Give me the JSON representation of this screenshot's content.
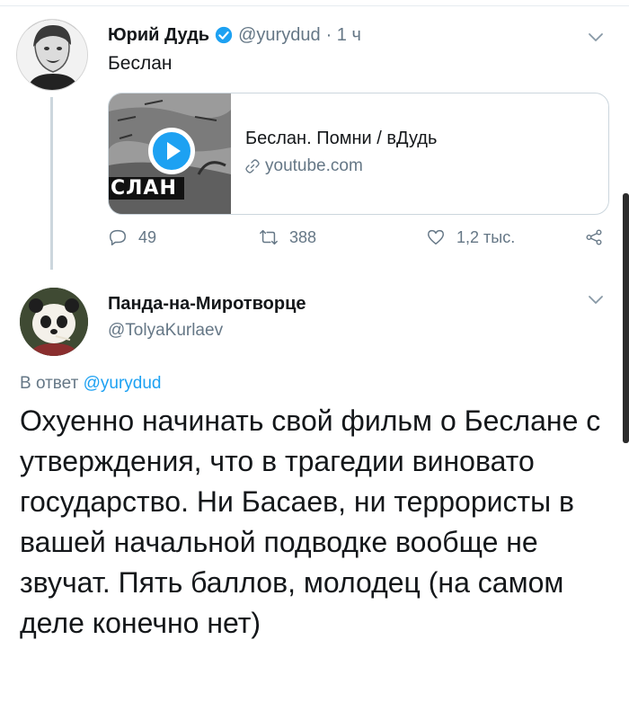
{
  "tweet1": {
    "author_name": "Юрий Дудь",
    "author_handle": "@yurydud",
    "time": "· 1 ч",
    "text": "Беслан",
    "card": {
      "thumbnail_caption": "СЛАН",
      "title": "Беслан. Помни / вДудь",
      "domain": "youtube.com"
    },
    "actions": {
      "replies": "49",
      "retweets": "388",
      "likes": "1,2 тыс."
    }
  },
  "tweet2": {
    "author_name": "Панда-на-Миротворце",
    "author_handle": "@TolyaKurlaev",
    "reply_prefix": "В ответ",
    "reply_mention": "@yurydud",
    "text": "Охуенно начинать свой фильм о Беслане с утверждения, что в трагедии виновато государство. Ни Басаев, ни террористы в вашей начальной подводке вообще не звучат. Пять баллов, молодец (на самом деле конечно нет)"
  },
  "icons": [
    "verified-icon",
    "chevron-down-icon",
    "play-icon",
    "link-icon",
    "reply-icon",
    "retweet-icon",
    "like-icon",
    "share-icon"
  ],
  "colors": {
    "accent": "#1da1f2",
    "secondary_text": "#657786",
    "border": "#ccd6dd"
  }
}
